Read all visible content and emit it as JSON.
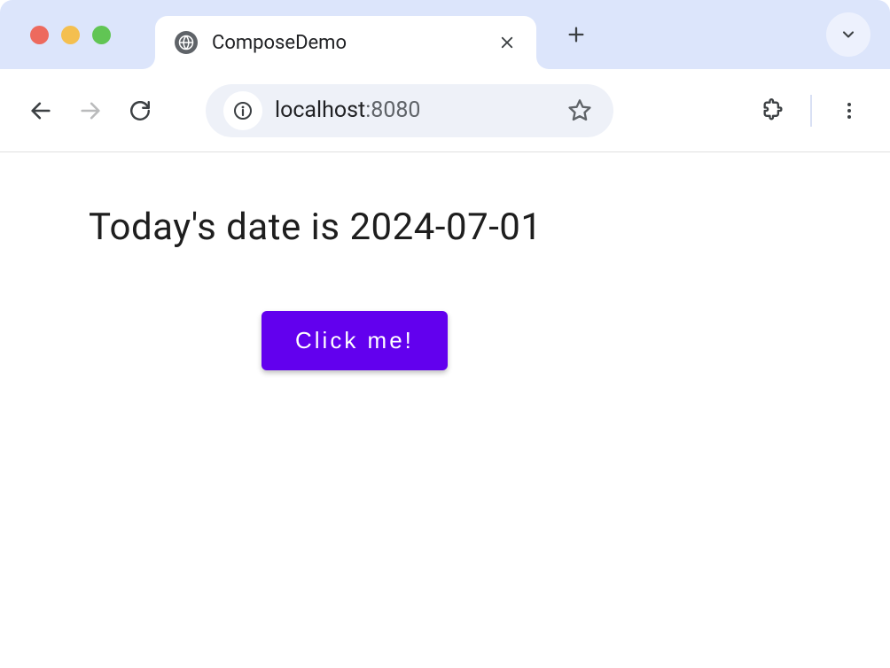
{
  "tab": {
    "title": "ComposeDemo"
  },
  "address": {
    "host": "localhost",
    "port": ":8080"
  },
  "content": {
    "heading": "Today's date is 2024-07-01",
    "button_label": "Click me!"
  }
}
